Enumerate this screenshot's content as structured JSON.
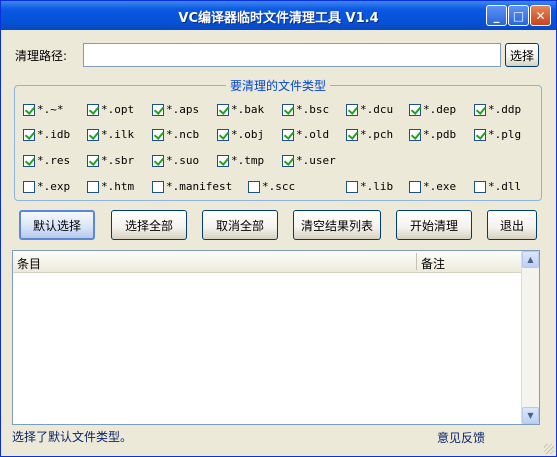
{
  "window": {
    "title": "VC编译器临时文件清理工具 V1.4"
  },
  "titlebar_buttons": {
    "minimize": "_",
    "maximize": "□",
    "close": "✕"
  },
  "path": {
    "label": "清理路径:",
    "value": "",
    "browse_label": "选择"
  },
  "filetypes": {
    "title": "要清理的文件类型",
    "items": [
      {
        "label": "*.~*",
        "checked": true
      },
      {
        "label": "*.opt",
        "checked": true
      },
      {
        "label": "*.aps",
        "checked": true
      },
      {
        "label": "*.bak",
        "checked": true
      },
      {
        "label": "*.bsc",
        "checked": true
      },
      {
        "label": "*.dcu",
        "checked": true
      },
      {
        "label": "*.dep",
        "checked": true
      },
      {
        "label": "*.ddp",
        "checked": true
      },
      {
        "label": "*.idb",
        "checked": true
      },
      {
        "label": "*.ilk",
        "checked": true
      },
      {
        "label": "*.ncb",
        "checked": true
      },
      {
        "label": "*.obj",
        "checked": true
      },
      {
        "label": "*.old",
        "checked": true
      },
      {
        "label": "*.pch",
        "checked": true
      },
      {
        "label": "*.pdb",
        "checked": true
      },
      {
        "label": "*.plg",
        "checked": true
      },
      {
        "label": "*.res",
        "checked": true
      },
      {
        "label": "*.sbr",
        "checked": true
      },
      {
        "label": "*.suo",
        "checked": true
      },
      {
        "label": "*.tmp",
        "checked": true
      },
      {
        "label": "*.user",
        "checked": true
      },
      {
        "label": "*.exp",
        "checked": false
      },
      {
        "label": "*.htm",
        "checked": false
      },
      {
        "label": "*.manifest",
        "checked": false
      },
      {
        "label": "*.scc",
        "checked": false
      },
      {
        "label": "*.lib",
        "checked": false
      },
      {
        "label": "*.exe",
        "checked": false
      },
      {
        "label": "*.dll",
        "checked": false
      }
    ]
  },
  "actions": {
    "default_select": "默认选择",
    "select_all": "选择全部",
    "deselect_all": "取消全部",
    "clear_results": "清空结果列表",
    "start_clean": "开始清理",
    "exit": "退出"
  },
  "results": {
    "columns": [
      "条目",
      "备注"
    ],
    "rows": []
  },
  "statusbar": {
    "message": "选择了默认文件类型。",
    "feedback_link": "意见反馈"
  }
}
